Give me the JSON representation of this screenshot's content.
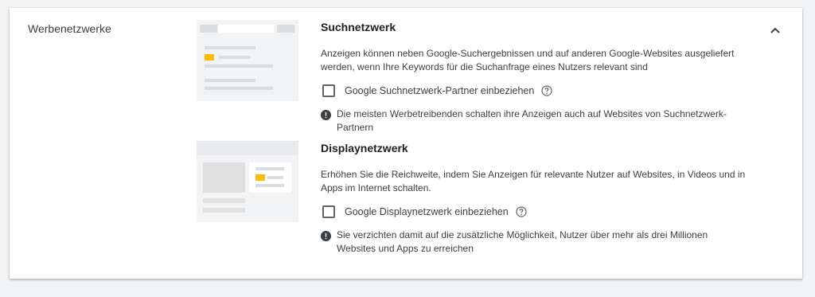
{
  "section": {
    "label": "Werbenetzwerke",
    "collapse_icon": "chevron-up-icon"
  },
  "search_network": {
    "title": "Suchnetzwerk",
    "description": "Anzeigen können neben Google-Suchergebnissen und auf anderen Google-Websites ausgeliefert werden, wenn Ihre Keywords für die Suchanfrage eines Nutzers relevant sind",
    "option_label": "Google Suchnetzwerk-Partner einbeziehen",
    "option_checked": false,
    "note": "Die meisten Werbetreibenden schalten ihre Anzeigen auch auf Websites von Suchnetzwerk-Partnern"
  },
  "display_network": {
    "title": "Displaynetzwerk",
    "description": "Erhöhen Sie die Reichweite, indem Sie Anzeigen für relevante Nutzer auf Websites, in Videos und in Apps im Internet schalten.",
    "option_label": "Google Displaynetzwerk einbeziehen",
    "option_checked": false,
    "note": "Sie verzichten damit auf die zusätzliche Möglichkeit, Nutzer über mehr als drei Millionen Websites und Apps zu erreichen"
  },
  "colors": {
    "accent_yellow": "#fbbc04",
    "note_icon": "#3c4043",
    "background": "#f1f3f4"
  }
}
